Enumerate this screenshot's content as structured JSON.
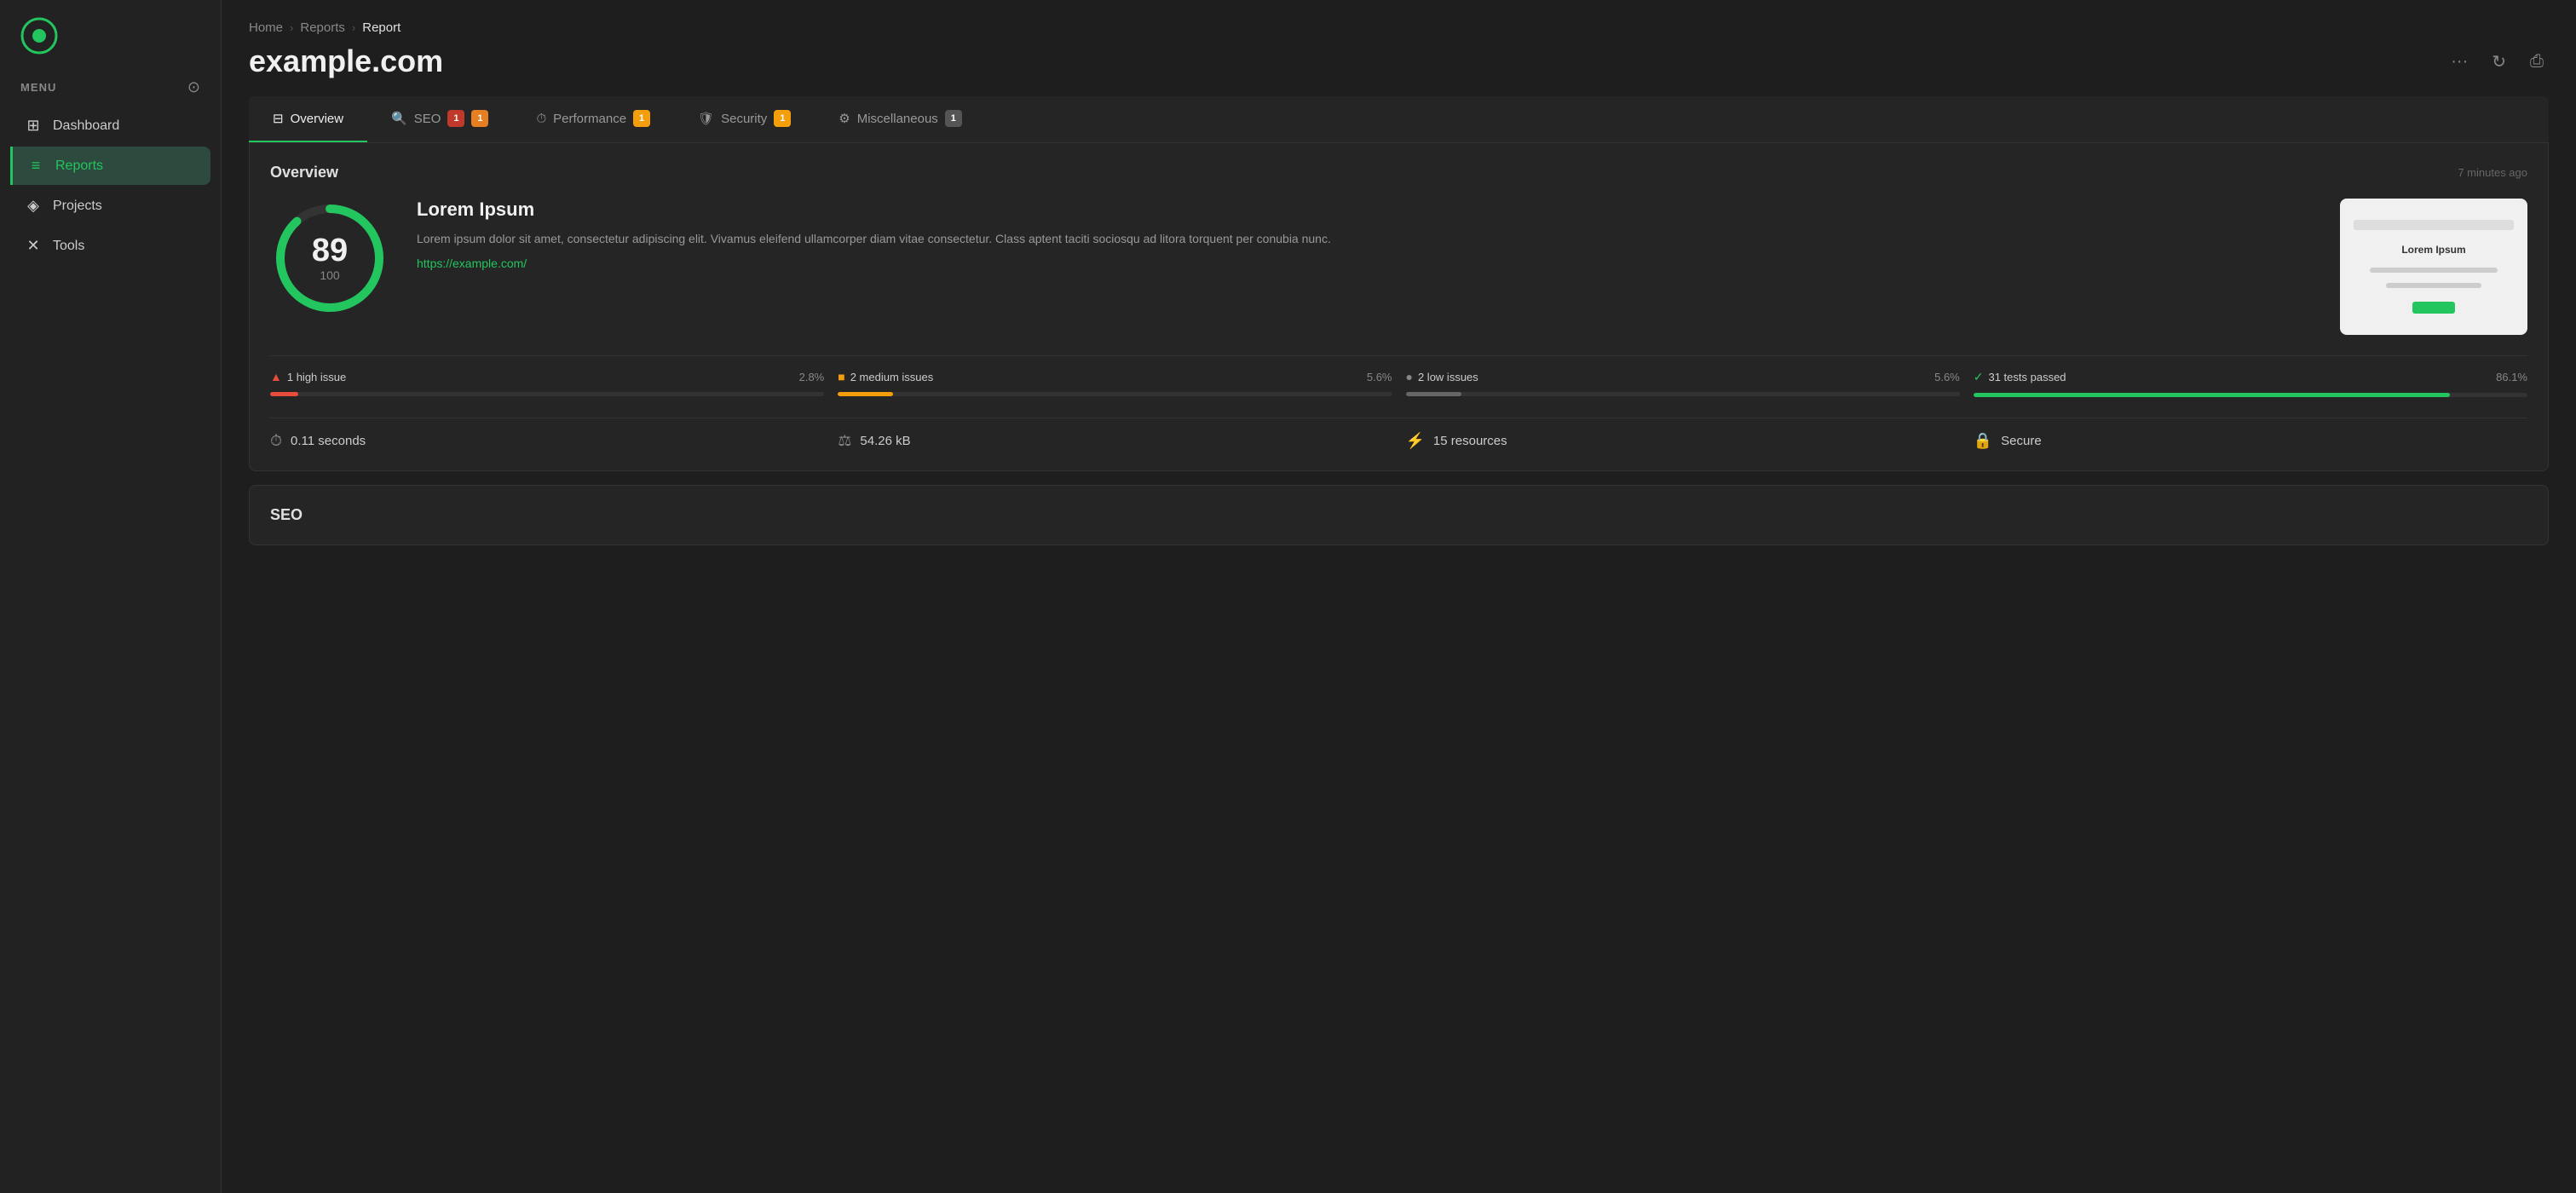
{
  "sidebar": {
    "logo_alt": "App Logo",
    "menu_label": "MENU",
    "nav_items": [
      {
        "id": "dashboard",
        "label": "Dashboard",
        "icon": "⊞",
        "active": false
      },
      {
        "id": "reports",
        "label": "Reports",
        "icon": "≡",
        "active": true
      },
      {
        "id": "projects",
        "label": "Projects",
        "icon": "◈",
        "active": false
      },
      {
        "id": "tools",
        "label": "Tools",
        "icon": "✕",
        "active": false
      }
    ]
  },
  "breadcrumb": {
    "items": [
      "Home",
      "Reports",
      "Report"
    ]
  },
  "page_title": "example.com",
  "header_actions": {
    "more_label": "···",
    "refresh_label": "↻",
    "print_label": "⎙"
  },
  "tabs": [
    {
      "id": "overview",
      "label": "Overview",
      "icon": "⊟",
      "badges": [],
      "active": true
    },
    {
      "id": "seo",
      "label": "SEO",
      "icon": "🔍",
      "badges": [
        {
          "count": "1",
          "type": "red"
        },
        {
          "count": "1",
          "type": "orange"
        }
      ],
      "active": false
    },
    {
      "id": "performance",
      "label": "Performance",
      "icon": "⏱",
      "badges": [
        {
          "count": "1",
          "type": "yellow"
        }
      ],
      "active": false
    },
    {
      "id": "security",
      "label": "Security",
      "icon": "🛡",
      "badges": [
        {
          "count": "1",
          "type": "yellow"
        }
      ],
      "active": false
    },
    {
      "id": "miscellaneous",
      "label": "Miscellaneous",
      "icon": "⚙",
      "badges": [
        {
          "count": "1",
          "type": "gray"
        }
      ],
      "active": false
    }
  ],
  "overview": {
    "title": "Overview",
    "time_ago": "7 minutes ago",
    "score": 89,
    "score_total": 100,
    "score_color": "#22c55e",
    "site_title": "Lorem Ipsum",
    "description": "Lorem ipsum dolor sit amet, consectetur adipiscing elit. Vivamus eleifend ullamcorper diam vitae consectetur. Class aptent taciti sociosqu ad litora torquent per conubia nunc.",
    "site_url": "https://example.com/",
    "issues": [
      {
        "id": "high",
        "icon": "▲",
        "icon_color": "#e74c3c",
        "label": "1 high issue",
        "percent": "2.8%",
        "bar_width": "5",
        "bar_color": "bar-red"
      },
      {
        "id": "medium",
        "icon": "■",
        "icon_color": "#f59e0b",
        "label": "2 medium issues",
        "percent": "5.6%",
        "bar_width": "10",
        "bar_color": "bar-yellow"
      },
      {
        "id": "low",
        "icon": "●",
        "icon_color": "#888",
        "label": "2 low issues",
        "percent": "5.6%",
        "bar_width": "10",
        "bar_color": "bar-gray"
      },
      {
        "id": "passed",
        "icon": "✓",
        "icon_color": "#22c55e",
        "label": "31 tests passed",
        "percent": "86.1%",
        "bar_width": "86",
        "bar_color": "bar-green"
      }
    ],
    "stats": [
      {
        "id": "time",
        "icon": "⏱",
        "value": "0.11 seconds"
      },
      {
        "id": "size",
        "icon": "⚖",
        "value": "54.26 kB"
      },
      {
        "id": "resources",
        "icon": "⚡",
        "value": "15 resources"
      },
      {
        "id": "security",
        "icon": "🔒",
        "value": "Secure"
      }
    ]
  },
  "seo_section": {
    "title": "SEO"
  }
}
